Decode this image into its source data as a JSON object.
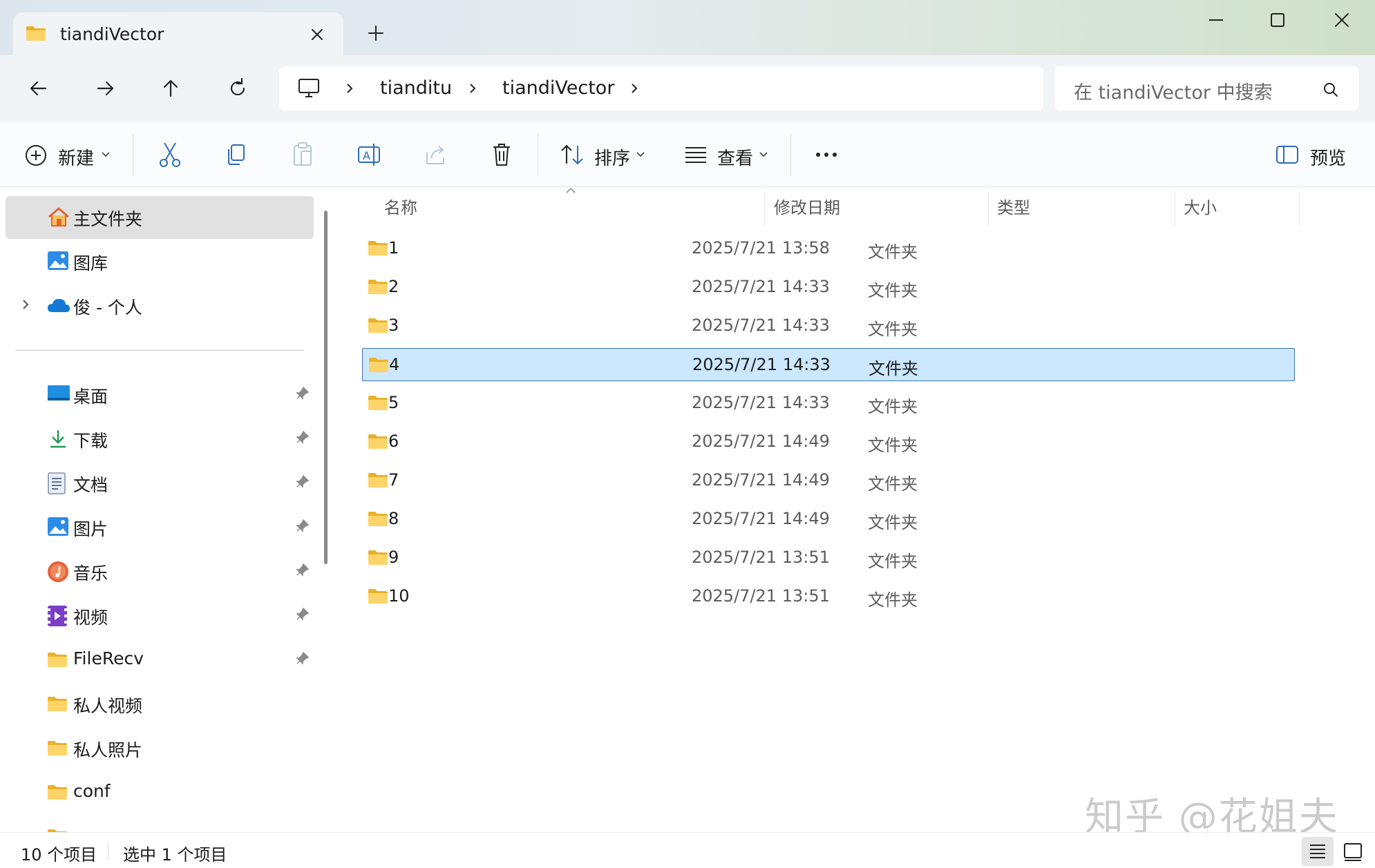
{
  "window": {
    "tab_title": "tiandiVector",
    "tab_icon": "folder-icon"
  },
  "nav": {
    "back": "back-arrow-icon",
    "forward": "forward-arrow-icon",
    "up": "up-arrow-icon",
    "refresh": "refresh-icon"
  },
  "address": {
    "root_icon": "computer-icon",
    "segments": [
      "tianditu",
      "tiandiVector"
    ]
  },
  "search": {
    "placeholder": "在 tiandiVector 中搜索"
  },
  "toolbar": {
    "new_label": "新建",
    "sort_label": "排序",
    "view_label": "查看",
    "more_label": "···",
    "preview_label": "预览"
  },
  "sidebar": {
    "items": [
      {
        "label": "主文件夹",
        "icon": "home-icon"
      },
      {
        "label": "图库",
        "icon": "gallery-icon"
      },
      {
        "label": "俊 - 个人",
        "icon": "onedrive-cloud-icon"
      },
      {
        "label": "桌面",
        "icon": "desktop-icon"
      },
      {
        "label": "下载",
        "icon": "download-icon"
      },
      {
        "label": "文档",
        "icon": "document-icon"
      },
      {
        "label": "图片",
        "icon": "pictures-icon"
      },
      {
        "label": "音乐",
        "icon": "music-icon"
      },
      {
        "label": "视频",
        "icon": "video-icon"
      },
      {
        "label": "FileRecv",
        "icon": "folder-icon"
      },
      {
        "label": "私人视频",
        "icon": "folder-icon"
      },
      {
        "label": "私人照片",
        "icon": "folder-icon"
      },
      {
        "label": "conf",
        "icon": "folder-icon"
      }
    ]
  },
  "columns": {
    "name": "名称",
    "date": "修改日期",
    "type": "类型",
    "size": "大小"
  },
  "files": [
    {
      "name": "1",
      "date": "2025/7/21 13:58",
      "type": "文件夹"
    },
    {
      "name": "2",
      "date": "2025/7/21 14:33",
      "type": "文件夹"
    },
    {
      "name": "3",
      "date": "2025/7/21 14:33",
      "type": "文件夹"
    },
    {
      "name": "4",
      "date": "2025/7/21 14:33",
      "type": "文件夹",
      "selected": true
    },
    {
      "name": "5",
      "date": "2025/7/21 14:33",
      "type": "文件夹"
    },
    {
      "name": "6",
      "date": "2025/7/21 14:49",
      "type": "文件夹"
    },
    {
      "name": "7",
      "date": "2025/7/21 14:49",
      "type": "文件夹"
    },
    {
      "name": "8",
      "date": "2025/7/21 14:49",
      "type": "文件夹"
    },
    {
      "name": "9",
      "date": "2025/7/21 13:51",
      "type": "文件夹"
    },
    {
      "name": "10",
      "date": "2025/7/21 13:51",
      "type": "文件夹"
    }
  ],
  "status": {
    "count": "10 个项目",
    "selected": "选中 1 个项目"
  },
  "watermark": "知乎 @花姐夫",
  "colors": {
    "selection_bg": "#cce8ff",
    "selection_border": "#3d6fb4",
    "folder_yellow": "#f7c948"
  }
}
